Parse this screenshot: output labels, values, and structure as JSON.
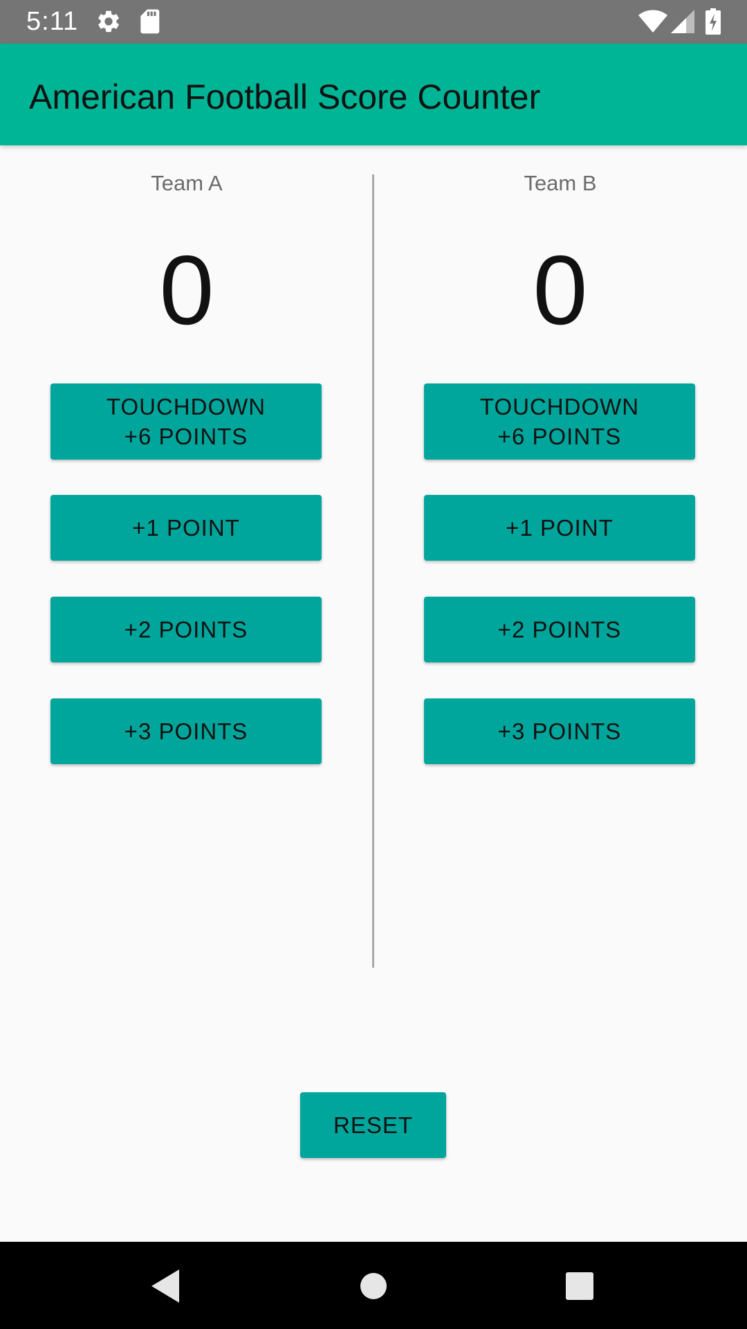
{
  "status_bar": {
    "time": "5:11",
    "icons_left": [
      "gear-icon",
      "sd-card-icon"
    ],
    "icons_right": [
      "wifi-icon",
      "cell-signal-icon",
      "battery-charging-icon"
    ]
  },
  "app_bar": {
    "title": "American Football Score Counter",
    "color": "#00b496"
  },
  "team_a": {
    "name": "Team A",
    "score": "0",
    "buttons": {
      "touchdown_line1": "TOUCHDOWN",
      "touchdown_line2": "+6 POINTS",
      "one_point": "+1 POINT",
      "two_points": "+2 POINTS",
      "three_points": "+3 POINTS"
    }
  },
  "team_b": {
    "name": "Team B",
    "score": "0",
    "buttons": {
      "touchdown_line1": "TOUCHDOWN",
      "touchdown_line2": "+6 POINTS",
      "one_point": "+1 POINT",
      "two_points": "+2 POINTS",
      "three_points": "+3 POINTS"
    }
  },
  "reset_label": "RESET",
  "button_color": "#00a59b",
  "nav_bar": {
    "icons": [
      "back-icon",
      "home-icon",
      "recents-icon"
    ]
  }
}
